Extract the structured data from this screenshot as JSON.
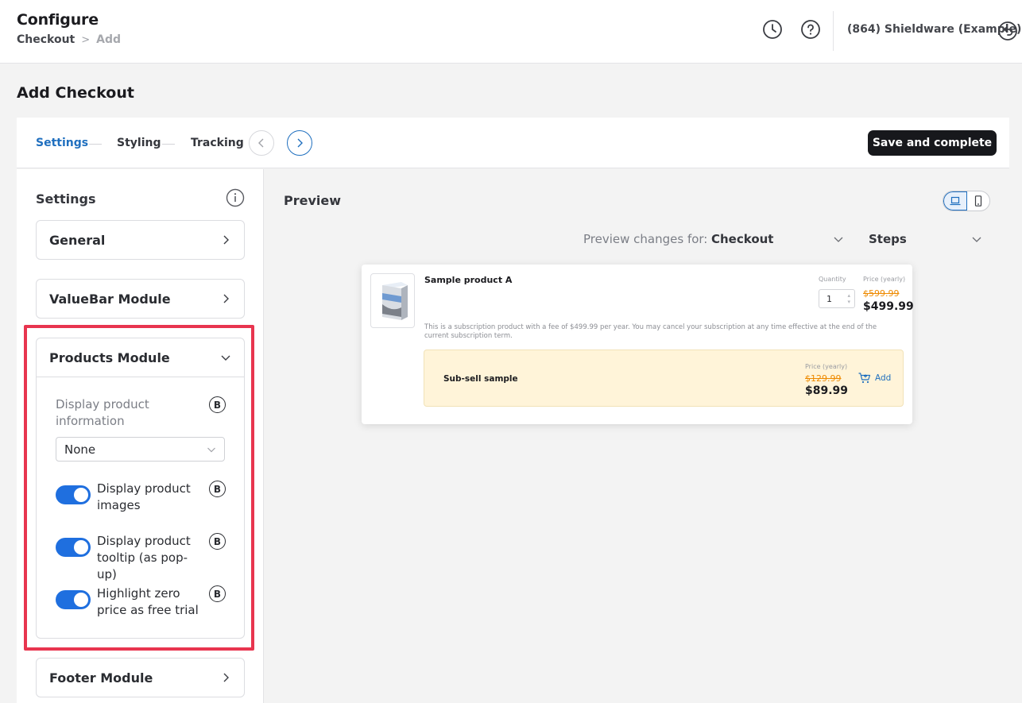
{
  "header": {
    "title": "Configure",
    "breadcrumb": {
      "parent": "Checkout",
      "separator": ">",
      "current": "Add"
    },
    "account": "(864) Shieldware (Example)"
  },
  "page": {
    "title": "Add Checkout"
  },
  "steps": {
    "items": [
      "Settings",
      "Styling",
      "Tracking"
    ],
    "save_label": "Save and complete"
  },
  "settings": {
    "title": "Settings",
    "modules": {
      "general": "General",
      "valuebar": "ValueBar Module",
      "products": "Products Module",
      "footer": "Footer Module"
    },
    "products": {
      "display_info_label": "Display product information",
      "display_info_value": "None",
      "badge": "B",
      "toggles": [
        {
          "label": "Display product images",
          "on": true
        },
        {
          "label": "Display product tooltip (as pop-up)",
          "on": true
        },
        {
          "label": "Highlight zero price as free trial",
          "on": true
        }
      ]
    }
  },
  "preview": {
    "title": "Preview",
    "changes_label": "Preview changes for:",
    "changes_value": "Checkout",
    "steps_value": "Steps",
    "product": {
      "name": "Sample product A",
      "quantity_label": "Quantity",
      "quantity": "1",
      "price_label": "Price (yearly)",
      "old_price": "$599.99",
      "new_price": "$499.99",
      "description": "This is a subscription product with a fee of $499.99 per year. You may cancel your subscription at any time effective at the end of the current subscription term."
    },
    "subsell": {
      "name": "Sub-sell sample",
      "price_label": "Price (yearly)",
      "old_price": "$129.99",
      "new_price": "$89.99",
      "add_label": "Add"
    }
  },
  "colors": {
    "accent": "#1f6fbf",
    "highlight": "#e8354f",
    "strike_price": "#ee8a00",
    "subsell_bg": "#fff4d9"
  }
}
